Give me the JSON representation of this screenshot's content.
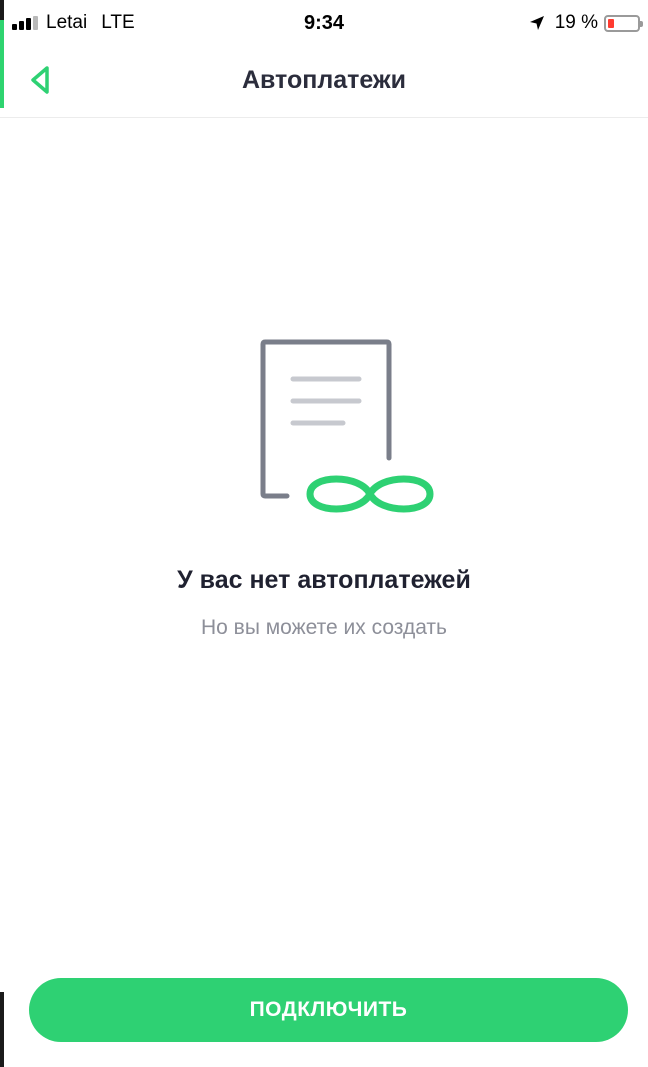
{
  "status_bar": {
    "carrier": "Letai",
    "network": "LTE",
    "time": "9:34",
    "battery_percent": "19 %",
    "signal_bars": 3,
    "signal_bars_total": 4,
    "icons": [
      "signal-icon",
      "location-arrow-icon",
      "battery-icon"
    ]
  },
  "nav": {
    "title": "Автоплатежи",
    "back_icon": "back-chevron-icon"
  },
  "empty_state": {
    "icon": "document-infinity-icon",
    "title": "У вас нет автоплатежей",
    "subtitle": "Но вы можете их создать"
  },
  "actions": {
    "connect_label": "ПОДКЛЮЧИТЬ"
  },
  "colors": {
    "accent": "#2ed173",
    "title_text": "#2b2d3c",
    "subtitle_text": "#8d8f99",
    "document_stroke": "#7a7e8a",
    "document_lines": "#c7c9cf",
    "battery_low": "#ff3b30"
  }
}
